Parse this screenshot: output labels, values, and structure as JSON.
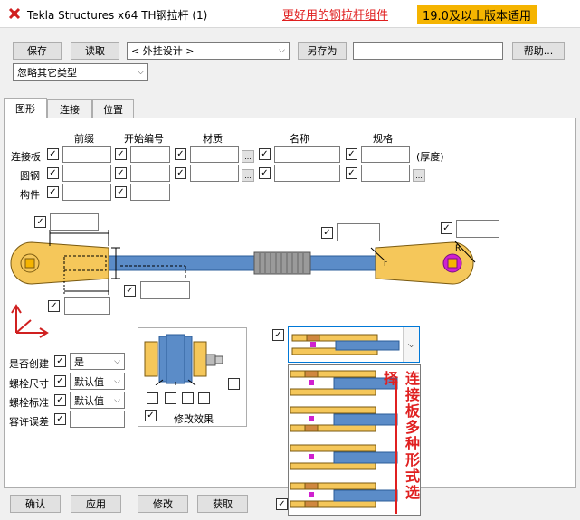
{
  "window": {
    "title": "Tekla Structures x64    TH钢拉杆 (1)"
  },
  "promo": {
    "text1": "更好用的钢拉杆组件",
    "text2": "19.0及以上版本适用"
  },
  "toolbar": {
    "save": "保存",
    "load": "读取",
    "preset": "< 外挂设计 >",
    "save_as": "另存为",
    "save_as_name": "",
    "help": "帮助..."
  },
  "filter": {
    "value": "忽略其它类型"
  },
  "tabs": [
    "图形",
    "连接",
    "位置"
  ],
  "columns": {
    "prefix": "前缀",
    "start_no": "开始编号",
    "material": "材质",
    "name": "名称",
    "profile": "规格"
  },
  "rows": {
    "plate": "连接板",
    "rod": "圆钢",
    "part": "构件",
    "thickness": "(厚度)"
  },
  "diagram": {
    "r_small": "r",
    "r_big": "R"
  },
  "options": {
    "create_label": "是否创建",
    "create_value": "是",
    "bolt_size_label": "螺栓尺寸",
    "bolt_size_value": "默认值",
    "bolt_std_label": "螺栓标准",
    "bolt_std_value": "默认值",
    "tolerance_label": "容许误差",
    "tolerance_value": ""
  },
  "bolt_panel": {
    "modify_effect": "修改效果"
  },
  "plate_style_note": "连接板多种形式选择",
  "bottom": {
    "ok": "确认",
    "apply": "应用",
    "modify": "修改",
    "get": "获取"
  },
  "colors": {
    "plate": "#f5c75a",
    "rod": "#5b8cc8",
    "accent": "#e02020",
    "magenta": "#d020d0"
  }
}
